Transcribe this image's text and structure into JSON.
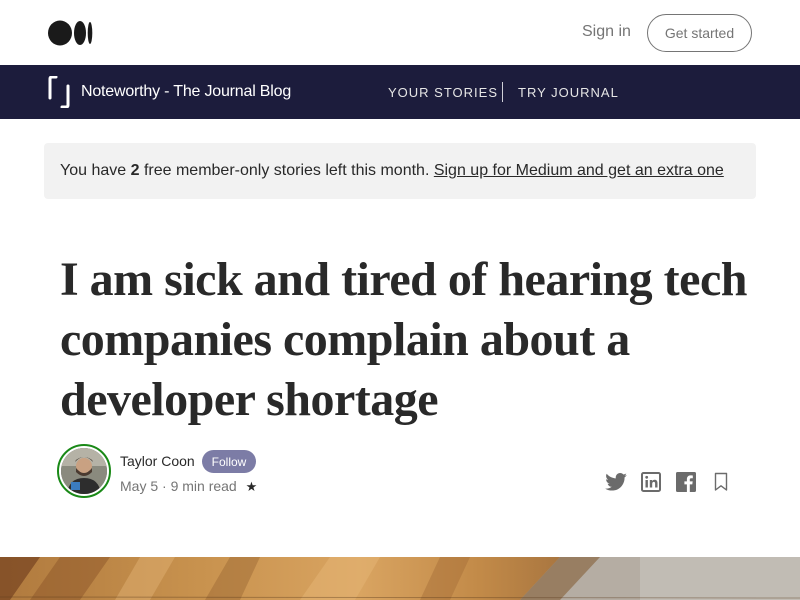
{
  "topbar": {
    "logo_icon": "medium-logo-icon",
    "signin_label": "Sign in",
    "getstarted_label": "Get started"
  },
  "publication": {
    "icon": "journal-bracket-icon",
    "name": "Noteworthy - The Journal Blog",
    "nav": [
      {
        "label": "YOUR STORIES"
      },
      {
        "label": "TRY JOURNAL"
      }
    ],
    "background": "#1c1c3c"
  },
  "banner": {
    "prefix": "You have ",
    "count": "2",
    "suffix": " free member-only stories left this month. ",
    "link": "Sign up for Medium and get an extra one"
  },
  "article": {
    "title": "I am sick and tired of hearing tech companies complain about a developer shortage",
    "author": "Taylor Coon",
    "follow_label": "Follow",
    "date": "May 5",
    "separator": "·",
    "read_time": "9 min read",
    "star": "★"
  },
  "share": {
    "icons": [
      "twitter-icon",
      "linkedin-icon",
      "facebook-icon",
      "bookmark-icon"
    ]
  },
  "colors": {
    "accent_green": "#1a8917",
    "follow_bg": "#7c7ca6",
    "text": "#292929",
    "muted": "#757575"
  }
}
